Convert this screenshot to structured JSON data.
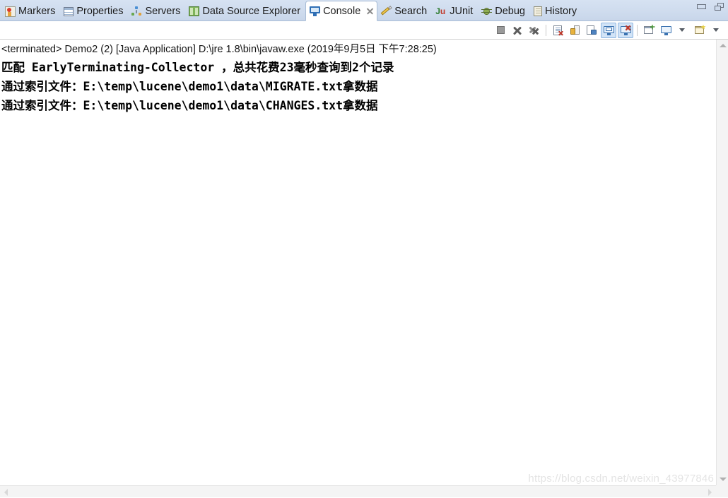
{
  "tabbar": {
    "tabs": [
      {
        "label": "Markers",
        "icon": "markers-icon",
        "active": false
      },
      {
        "label": "Properties",
        "icon": "properties-icon",
        "active": false
      },
      {
        "label": "Servers",
        "icon": "servers-icon",
        "active": false
      },
      {
        "label": "Data Source Explorer",
        "icon": "data-source-explorer-icon",
        "active": false
      },
      {
        "label": "Console",
        "icon": "console-icon",
        "active": true
      },
      {
        "label": "Search",
        "icon": "search-icon",
        "active": false
      },
      {
        "label": "JUnit",
        "icon": "junit-icon",
        "active": false
      },
      {
        "label": "Debug",
        "icon": "debug-icon",
        "active": false
      },
      {
        "label": "History",
        "icon": "history-icon",
        "active": false
      }
    ],
    "window_controls": [
      {
        "name": "minimize-button",
        "glyph": "minimize"
      },
      {
        "name": "maximize-button",
        "glyph": "maximize"
      }
    ]
  },
  "toolbar": {
    "buttons": [
      {
        "name": "terminate-button",
        "icon": "stop-square-icon",
        "toggled": false
      },
      {
        "name": "remove-launch-button",
        "icon": "cross-icon",
        "toggled": false
      },
      {
        "name": "remove-all-terminated-button",
        "icon": "double-cross-icon",
        "toggled": false
      },
      {
        "name": "clear-console-button",
        "icon": "clear-console-icon",
        "toggled": false
      },
      {
        "name": "scroll-lock-button",
        "icon": "lock-icon",
        "toggled": false
      },
      {
        "name": "word-wrap-button",
        "icon": "page-wrap-icon",
        "toggled": false
      },
      {
        "name": "show-console-on-output-button",
        "icon": "console-output-icon",
        "toggled": true
      },
      {
        "name": "show-console-on-error-button",
        "icon": "console-error-icon",
        "toggled": true
      },
      {
        "name": "pin-console-button",
        "icon": "pin-console-icon",
        "toggled": false
      },
      {
        "name": "display-selected-console-button",
        "icon": "monitor-icon",
        "toggled": false
      },
      {
        "name": "display-selected-console-dropdown",
        "icon": "chevron-down-icon",
        "toggled": false
      },
      {
        "name": "open-console-button",
        "icon": "new-console-icon",
        "toggled": false
      },
      {
        "name": "open-console-dropdown",
        "icon": "chevron-down-icon",
        "toggled": false
      }
    ]
  },
  "console": {
    "process_line": "<terminated> Demo2 (2) [Java Application] D:\\jre 1.8\\bin\\javaw.exe (2019年9月5日 下午7:28:25)",
    "output_lines": [
      "匹配 EarlyTerminating-Collector ，总共花费23毫秒查询到2个记录",
      "通过索引文件：E:\\temp\\lucene\\demo1\\data\\MIGRATE.txt拿数据",
      "通过索引文件：E:\\temp\\lucene\\demo1\\data\\CHANGES.txt拿数据"
    ],
    "watermark": "https://blog.csdn.net/weixin_43977846"
  },
  "colors": {
    "tabbar_bg": "#cfdcee",
    "active_tab_bg": "#ffffff",
    "console_bg": "#ffffff",
    "text": "#000000",
    "toggled_button_bg": "#d2e4f7",
    "scrollbar_bg": "#f4f4f4",
    "watermark": "#e4e4e4"
  }
}
